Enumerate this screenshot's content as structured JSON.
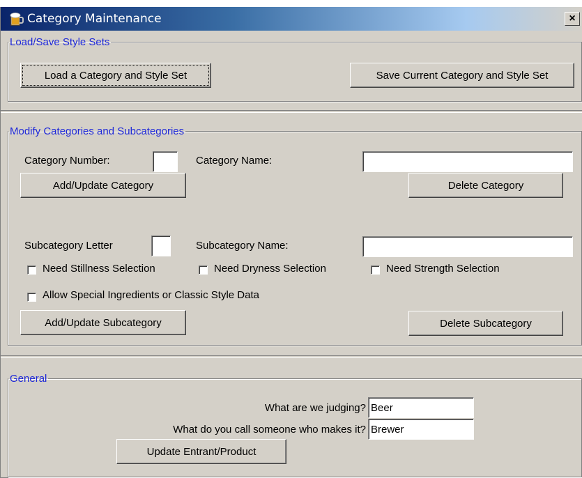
{
  "window": {
    "title": "Category Maintenance",
    "close_label": "×"
  },
  "load_save": {
    "legend": "Load/Save Style Sets",
    "load_label": "Load a Category and Style Set",
    "save_label": "Save Current Category and Style Set"
  },
  "modify": {
    "legend": "Modify Categories and Subcategories",
    "category_number_label": "Category Number:",
    "category_number_value": "",
    "category_name_label": "Category Name:",
    "category_name_value": "",
    "add_update_category_label": "Add/Update Category",
    "delete_category_label": "Delete Category",
    "subcategory_letter_label": "Subcategory Letter",
    "subcategory_letter_value": "",
    "subcategory_name_label": "Subcategory Name:",
    "subcategory_name_value": "",
    "need_stillness_label": "Need Stillness Selection",
    "need_dryness_label": "Need Dryness Selection",
    "need_strength_label": "Need Strength Selection",
    "allow_special_label": "Allow Special Ingredients or Classic Style Data",
    "add_update_subcategory_label": "Add/Update Subcategory",
    "delete_subcategory_label": "Delete Subcategory",
    "checked": {
      "stillness": false,
      "dryness": false,
      "strength": false,
      "special": false
    }
  },
  "general": {
    "legend": "General",
    "judging_label": "What are we judging?",
    "judging_value": "Beer",
    "maker_label": "What do you call someone who makes it?",
    "maker_value": "Brewer",
    "update_label": "Update Entrant/Product"
  }
}
